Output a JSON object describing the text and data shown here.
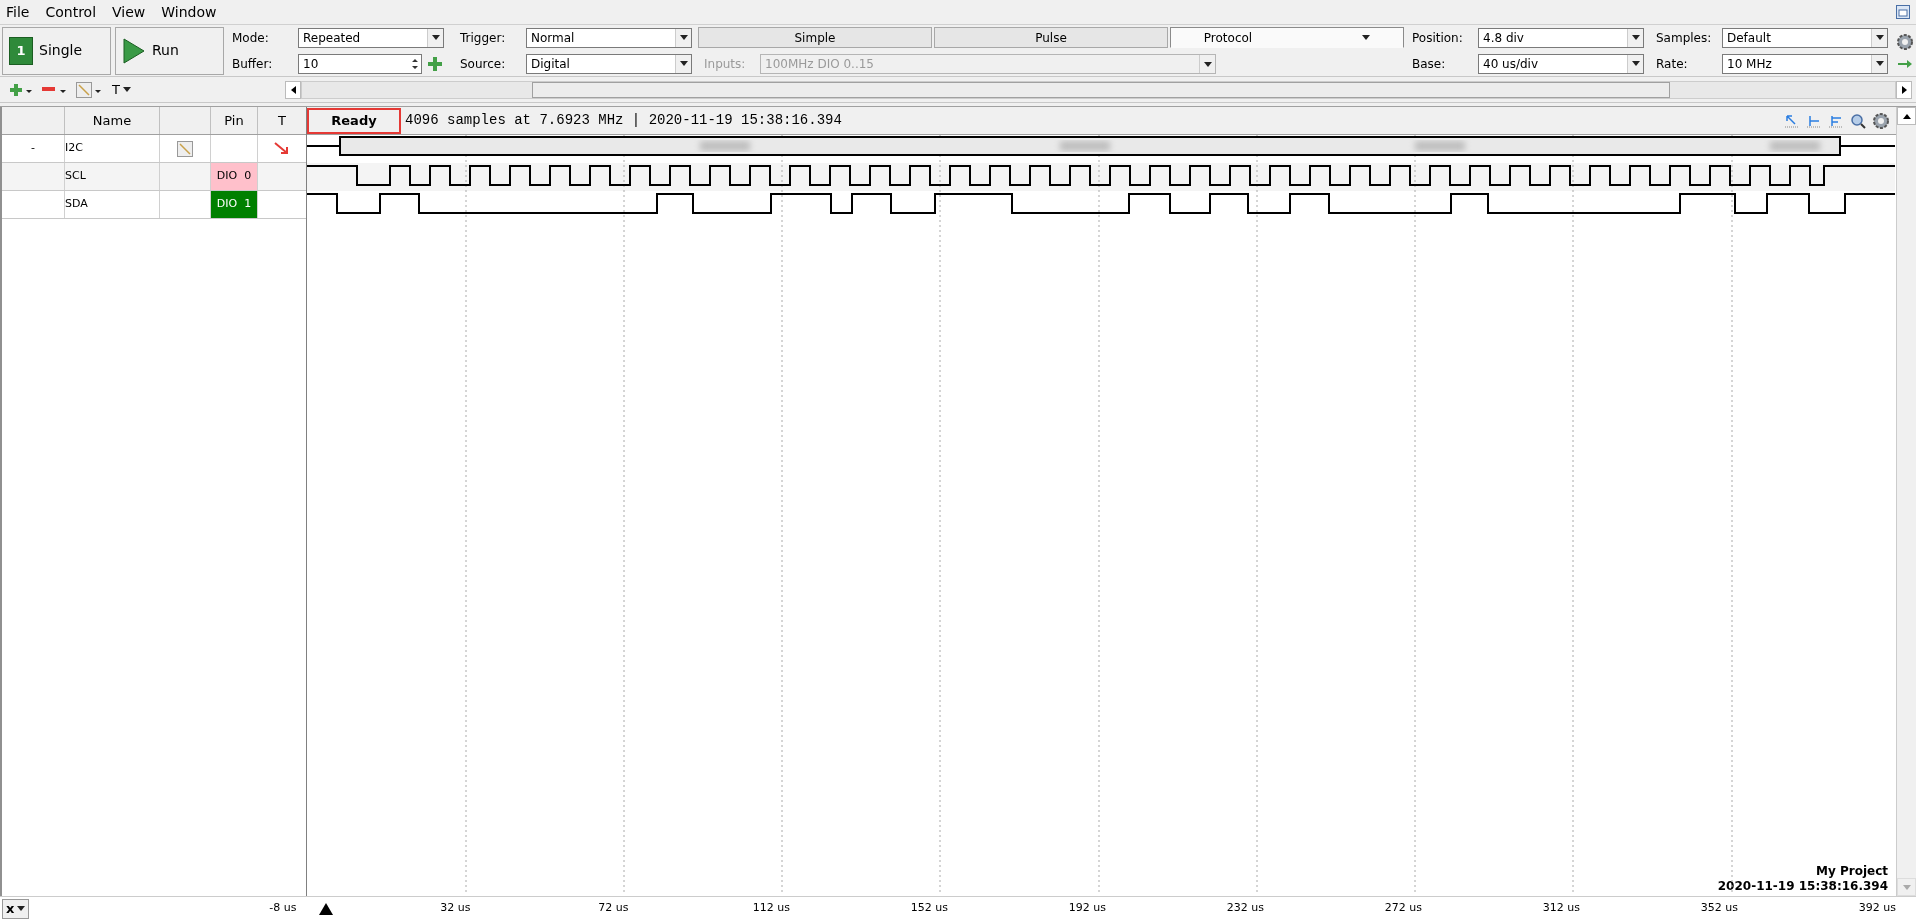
{
  "menu": [
    "File",
    "Control",
    "View",
    "Window"
  ],
  "acquire": [
    {
      "kind": "single",
      "label": "Single",
      "badge": "1"
    },
    {
      "kind": "run",
      "label": "Run"
    }
  ],
  "mode": {
    "label": "Mode:",
    "value": "Repeated"
  },
  "buffer": {
    "label": "Buffer:",
    "value": "10"
  },
  "trigger": {
    "label": "Trigger:",
    "value": "Normal"
  },
  "source": {
    "label": "Source:",
    "value": "Digital"
  },
  "trigger_tabs": [
    {
      "label": "Simple",
      "selected": false
    },
    {
      "label": "Pulse",
      "selected": false
    },
    {
      "label": "Protocol",
      "selected": true
    }
  ],
  "inputs": {
    "label": "Inputs:",
    "value": "100MHz DIO 0..15",
    "disabled": true
  },
  "position": {
    "label": "Position:",
    "value": "4.8 div"
  },
  "base": {
    "label": "Base:",
    "value": "40 us/div"
  },
  "samples": {
    "label": "Samples:",
    "value": "Default"
  },
  "rate": {
    "label": "Rate:",
    "value": "10 MHz"
  },
  "text_tool": "T",
  "columns": [
    "Name",
    "Pin",
    "T"
  ],
  "status": "Ready",
  "info": "4096 samples at 7.6923 MHz | 2020-11-19 15:38:16.394",
  "signals": [
    {
      "kind": "bus",
      "expander": "-",
      "name": "I2C"
    },
    {
      "kind": "digital",
      "name": "SCL",
      "pin": "DIO  0",
      "color": "#ffc0cb"
    },
    {
      "kind": "digital",
      "name": "SDA",
      "pin": "DIO  1",
      "color": "#008000"
    }
  ],
  "axis": [
    "-8 us",
    "32 us",
    "72 us",
    "112 us",
    "152 us",
    "192 us",
    "232 us",
    "272 us",
    "312 us",
    "352 us",
    "392 us"
  ],
  "project": {
    "name": "My Project",
    "time": "2020-11-19 15:38:16.394"
  },
  "cursor_button": "x"
}
